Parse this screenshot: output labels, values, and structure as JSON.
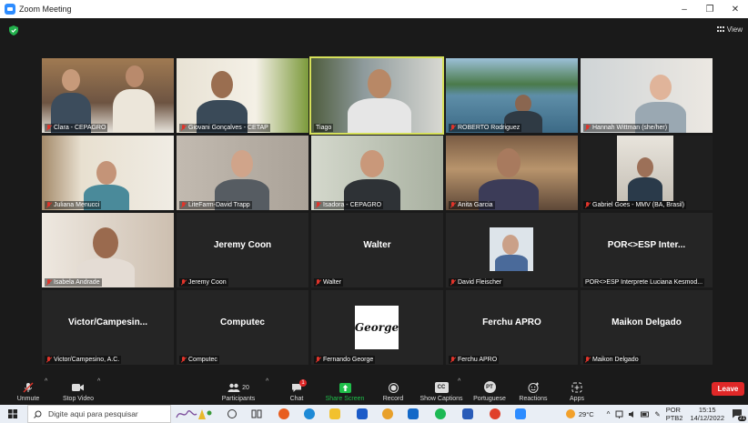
{
  "window": {
    "title": "Zoom Meeting",
    "minimize": "–",
    "restore": "❐",
    "close": "✕"
  },
  "view_label": "View",
  "tiles": [
    {
      "name": "Clara - CEPAGRO",
      "muted": true,
      "video": true
    },
    {
      "name": "Giovani Gonçalves  - CETAP",
      "muted": true,
      "video": true
    },
    {
      "name": "Tiago",
      "muted": false,
      "video": true,
      "active": true
    },
    {
      "name": "ROBERTO Rodriguez",
      "muted": true,
      "video": true
    },
    {
      "name": "Hannah Wittman (she/her)",
      "muted": true,
      "video": true
    },
    {
      "name": "Juliana Menucci",
      "muted": true,
      "video": true
    },
    {
      "name": "LiteFarm-David Trapp",
      "muted": true,
      "video": true
    },
    {
      "name": "Isadora - CEPAGRO",
      "muted": true,
      "video": true
    },
    {
      "name": "Anita Garcia",
      "muted": true,
      "video": true
    },
    {
      "name": "Gabriel Goes - MMV (BA, Brasil)",
      "muted": true,
      "video": true
    },
    {
      "name": "Isabela Andrade",
      "muted": true,
      "video": true
    },
    {
      "name": "Jeremy Coon",
      "display": "Jeremy Coon",
      "muted": true,
      "video": false
    },
    {
      "name": "Walter",
      "display": "Walter",
      "muted": true,
      "video": false
    },
    {
      "name": "David Fleischer",
      "muted": true,
      "video": false,
      "photo": true
    },
    {
      "name": "POR<>ESP Interprete Luciana Kesmod...",
      "display": "POR<>ESP Inter...",
      "muted": false,
      "video": false
    },
    {
      "name": "Victor/Campesino, A.C.",
      "display": "Victor/Campesin...",
      "muted": true,
      "video": false
    },
    {
      "name": "Computec",
      "display": "Computec",
      "muted": true,
      "video": false
    },
    {
      "name": "Fernando George",
      "display": "George",
      "muted": true,
      "video": false,
      "card": true
    },
    {
      "name": "Ferchu APRO",
      "display": "Ferchu APRO",
      "muted": true,
      "video": false
    },
    {
      "name": "Maikon Delgado",
      "display": "Maikon Delgado",
      "muted": true,
      "video": false
    }
  ],
  "toolbar": {
    "unmute": "Unmute",
    "stop_video": "Stop Video",
    "participants": "Participants",
    "participants_count": "20",
    "chat": "Chat",
    "chat_badge": "1",
    "share_screen": "Share Screen",
    "record": "Record",
    "captions": "Show Captions",
    "captions_icon": "CC",
    "language": "Portuguese",
    "language_icon": "PT",
    "reactions": "Reactions",
    "apps": "Apps",
    "leave": "Leave"
  },
  "taskbar": {
    "search_placeholder": "Digite aqui para pesquisar",
    "weather": "29°C",
    "lang_top": "POR",
    "lang_bottom": "PTB2",
    "time": "15:15",
    "date": "14/12/2022",
    "notifications": "21"
  },
  "colors": {
    "active_speaker": "#d6e05a",
    "muted": "#e0342a",
    "leave": "#e02828",
    "share": "#1fbf4a",
    "zoom_blue": "#2d8cff"
  }
}
